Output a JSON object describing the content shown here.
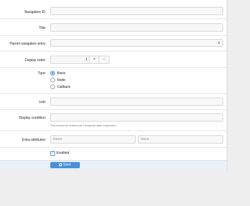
{
  "form": {
    "navigation_id": {
      "label": "Navigation ID:",
      "value": ""
    },
    "title": {
      "label": "Title:",
      "value": ""
    },
    "parent": {
      "label": "Parent navigation entry:",
      "value": ""
    },
    "display_order": {
      "label": "Display order:",
      "value": "1",
      "plus": "+",
      "minus": "−"
    },
    "type": {
      "label": "Type:",
      "options": [
        "Basic",
        "Node",
        "Callback"
      ],
      "selected": "Basic"
    },
    "link": {
      "label": "Link:",
      "value": ""
    },
    "display_condition": {
      "label": "Display condition:",
      "value": "",
      "hint": "This should be entered as a template-style expression."
    },
    "extra_attributes": {
      "label": "Extra attributes:",
      "name_placeholder": "Name",
      "value_placeholder": "Value"
    },
    "enabled": {
      "label": "Enabled",
      "checked": true
    },
    "save": {
      "label": "Save",
      "icon": "save-icon"
    }
  },
  "colors": {
    "accent": "#4a90d9",
    "footer_bg": "#e8f0f8",
    "page_bg": "#eeeeee"
  }
}
